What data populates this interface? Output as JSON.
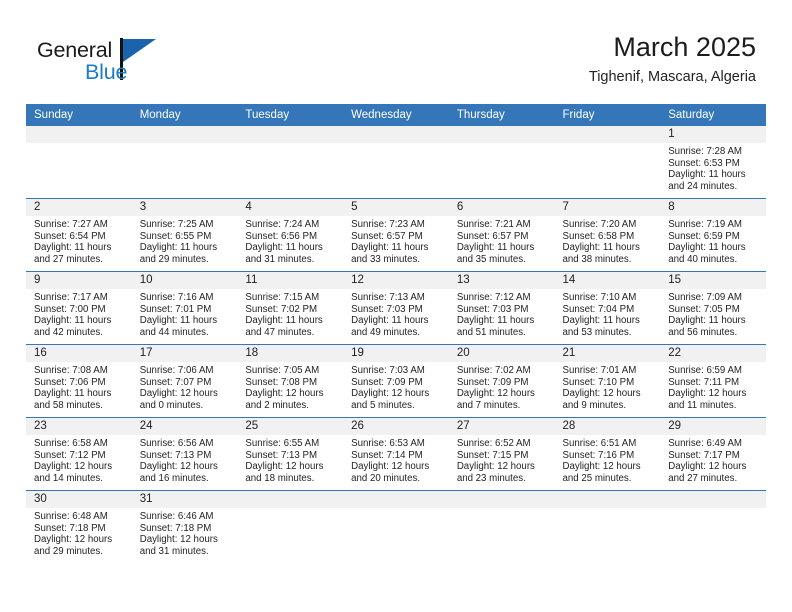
{
  "brand": {
    "name_part1": "General",
    "name_part2": "Blue",
    "logo_icon": "blue-flag-triangle-icon"
  },
  "header": {
    "title": "March 2025",
    "subtitle": "Tighenif, Mascara, Algeria"
  },
  "colors": {
    "header_blue": "#3576b8",
    "brand_blue": "#1d7cc4",
    "daystrip_gray": "#f1f1f1"
  },
  "weekdays": [
    "Sunday",
    "Monday",
    "Tuesday",
    "Wednesday",
    "Thursday",
    "Friday",
    "Saturday"
  ],
  "labels": {
    "sunrise_prefix": "Sunrise:",
    "sunset_prefix": "Sunset:",
    "daylight_prefix": "Daylight:"
  },
  "weeks": [
    [
      {
        "day": "",
        "line1": "",
        "line2": "",
        "line3": "",
        "line4": ""
      },
      {
        "day": "",
        "line1": "",
        "line2": "",
        "line3": "",
        "line4": ""
      },
      {
        "day": "",
        "line1": "",
        "line2": "",
        "line3": "",
        "line4": ""
      },
      {
        "day": "",
        "line1": "",
        "line2": "",
        "line3": "",
        "line4": ""
      },
      {
        "day": "",
        "line1": "",
        "line2": "",
        "line3": "",
        "line4": ""
      },
      {
        "day": "",
        "line1": "",
        "line2": "",
        "line3": "",
        "line4": ""
      },
      {
        "day": "1",
        "line1": "Sunrise: 7:28 AM",
        "line2": "Sunset: 6:53 PM",
        "line3": "Daylight: 11 hours",
        "line4": "and 24 minutes."
      }
    ],
    [
      {
        "day": "2",
        "line1": "Sunrise: 7:27 AM",
        "line2": "Sunset: 6:54 PM",
        "line3": "Daylight: 11 hours",
        "line4": "and 27 minutes."
      },
      {
        "day": "3",
        "line1": "Sunrise: 7:25 AM",
        "line2": "Sunset: 6:55 PM",
        "line3": "Daylight: 11 hours",
        "line4": "and 29 minutes."
      },
      {
        "day": "4",
        "line1": "Sunrise: 7:24 AM",
        "line2": "Sunset: 6:56 PM",
        "line3": "Daylight: 11 hours",
        "line4": "and 31 minutes."
      },
      {
        "day": "5",
        "line1": "Sunrise: 7:23 AM",
        "line2": "Sunset: 6:57 PM",
        "line3": "Daylight: 11 hours",
        "line4": "and 33 minutes."
      },
      {
        "day": "6",
        "line1": "Sunrise: 7:21 AM",
        "line2": "Sunset: 6:57 PM",
        "line3": "Daylight: 11 hours",
        "line4": "and 35 minutes."
      },
      {
        "day": "7",
        "line1": "Sunrise: 7:20 AM",
        "line2": "Sunset: 6:58 PM",
        "line3": "Daylight: 11 hours",
        "line4": "and 38 minutes."
      },
      {
        "day": "8",
        "line1": "Sunrise: 7:19 AM",
        "line2": "Sunset: 6:59 PM",
        "line3": "Daylight: 11 hours",
        "line4": "and 40 minutes."
      }
    ],
    [
      {
        "day": "9",
        "line1": "Sunrise: 7:17 AM",
        "line2": "Sunset: 7:00 PM",
        "line3": "Daylight: 11 hours",
        "line4": "and 42 minutes."
      },
      {
        "day": "10",
        "line1": "Sunrise: 7:16 AM",
        "line2": "Sunset: 7:01 PM",
        "line3": "Daylight: 11 hours",
        "line4": "and 44 minutes."
      },
      {
        "day": "11",
        "line1": "Sunrise: 7:15 AM",
        "line2": "Sunset: 7:02 PM",
        "line3": "Daylight: 11 hours",
        "line4": "and 47 minutes."
      },
      {
        "day": "12",
        "line1": "Sunrise: 7:13 AM",
        "line2": "Sunset: 7:03 PM",
        "line3": "Daylight: 11 hours",
        "line4": "and 49 minutes."
      },
      {
        "day": "13",
        "line1": "Sunrise: 7:12 AM",
        "line2": "Sunset: 7:03 PM",
        "line3": "Daylight: 11 hours",
        "line4": "and 51 minutes."
      },
      {
        "day": "14",
        "line1": "Sunrise: 7:10 AM",
        "line2": "Sunset: 7:04 PM",
        "line3": "Daylight: 11 hours",
        "line4": "and 53 minutes."
      },
      {
        "day": "15",
        "line1": "Sunrise: 7:09 AM",
        "line2": "Sunset: 7:05 PM",
        "line3": "Daylight: 11 hours",
        "line4": "and 56 minutes."
      }
    ],
    [
      {
        "day": "16",
        "line1": "Sunrise: 7:08 AM",
        "line2": "Sunset: 7:06 PM",
        "line3": "Daylight: 11 hours",
        "line4": "and 58 minutes."
      },
      {
        "day": "17",
        "line1": "Sunrise: 7:06 AM",
        "line2": "Sunset: 7:07 PM",
        "line3": "Daylight: 12 hours",
        "line4": "and 0 minutes."
      },
      {
        "day": "18",
        "line1": "Sunrise: 7:05 AM",
        "line2": "Sunset: 7:08 PM",
        "line3": "Daylight: 12 hours",
        "line4": "and 2 minutes."
      },
      {
        "day": "19",
        "line1": "Sunrise: 7:03 AM",
        "line2": "Sunset: 7:09 PM",
        "line3": "Daylight: 12 hours",
        "line4": "and 5 minutes."
      },
      {
        "day": "20",
        "line1": "Sunrise: 7:02 AM",
        "line2": "Sunset: 7:09 PM",
        "line3": "Daylight: 12 hours",
        "line4": "and 7 minutes."
      },
      {
        "day": "21",
        "line1": "Sunrise: 7:01 AM",
        "line2": "Sunset: 7:10 PM",
        "line3": "Daylight: 12 hours",
        "line4": "and 9 minutes."
      },
      {
        "day": "22",
        "line1": "Sunrise: 6:59 AM",
        "line2": "Sunset: 7:11 PM",
        "line3": "Daylight: 12 hours",
        "line4": "and 11 minutes."
      }
    ],
    [
      {
        "day": "23",
        "line1": "Sunrise: 6:58 AM",
        "line2": "Sunset: 7:12 PM",
        "line3": "Daylight: 12 hours",
        "line4": "and 14 minutes."
      },
      {
        "day": "24",
        "line1": "Sunrise: 6:56 AM",
        "line2": "Sunset: 7:13 PM",
        "line3": "Daylight: 12 hours",
        "line4": "and 16 minutes."
      },
      {
        "day": "25",
        "line1": "Sunrise: 6:55 AM",
        "line2": "Sunset: 7:13 PM",
        "line3": "Daylight: 12 hours",
        "line4": "and 18 minutes."
      },
      {
        "day": "26",
        "line1": "Sunrise: 6:53 AM",
        "line2": "Sunset: 7:14 PM",
        "line3": "Daylight: 12 hours",
        "line4": "and 20 minutes."
      },
      {
        "day": "27",
        "line1": "Sunrise: 6:52 AM",
        "line2": "Sunset: 7:15 PM",
        "line3": "Daylight: 12 hours",
        "line4": "and 23 minutes."
      },
      {
        "day": "28",
        "line1": "Sunrise: 6:51 AM",
        "line2": "Sunset: 7:16 PM",
        "line3": "Daylight: 12 hours",
        "line4": "and 25 minutes."
      },
      {
        "day": "29",
        "line1": "Sunrise: 6:49 AM",
        "line2": "Sunset: 7:17 PM",
        "line3": "Daylight: 12 hours",
        "line4": "and 27 minutes."
      }
    ],
    [
      {
        "day": "30",
        "line1": "Sunrise: 6:48 AM",
        "line2": "Sunset: 7:18 PM",
        "line3": "Daylight: 12 hours",
        "line4": "and 29 minutes."
      },
      {
        "day": "31",
        "line1": "Sunrise: 6:46 AM",
        "line2": "Sunset: 7:18 PM",
        "line3": "Daylight: 12 hours",
        "line4": "and 31 minutes."
      },
      {
        "day": "",
        "line1": "",
        "line2": "",
        "line3": "",
        "line4": ""
      },
      {
        "day": "",
        "line1": "",
        "line2": "",
        "line3": "",
        "line4": ""
      },
      {
        "day": "",
        "line1": "",
        "line2": "",
        "line3": "",
        "line4": ""
      },
      {
        "day": "",
        "line1": "",
        "line2": "",
        "line3": "",
        "line4": ""
      },
      {
        "day": "",
        "line1": "",
        "line2": "",
        "line3": "",
        "line4": ""
      }
    ]
  ]
}
